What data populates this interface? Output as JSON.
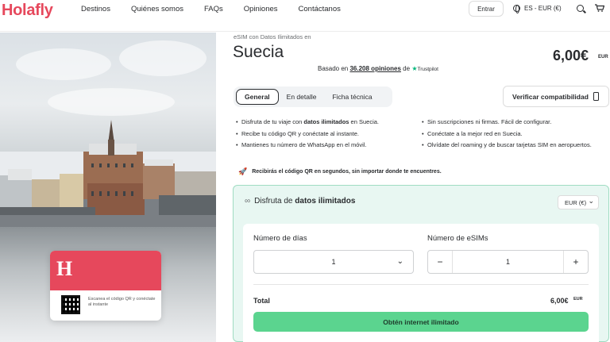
{
  "header": {
    "logo": "Holafly",
    "nav": [
      "Destinos",
      "Quiénes somos",
      "FAQs",
      "Opiniones",
      "Contáctanos"
    ],
    "login_label": "Entrar",
    "locale": "ES - EUR (€)"
  },
  "hero": {
    "card_logo": "H",
    "card_text": "Escanea el código QR y conéctate al instante"
  },
  "product": {
    "eyebrow": "eSIM con Datos Ilimitados en",
    "country": "Suecia",
    "price": "6,00€",
    "price_currency": "EUR",
    "rating_prefix": "Basado en ",
    "rating_count": "36.208 opiniones",
    "rating_suffix": " de",
    "trustpilot": "Trustpilot"
  },
  "tabs": [
    "General",
    "En detalle",
    "Ficha técnica"
  ],
  "compat_label": "Verificar compatibilidad",
  "features_left": [
    [
      "Disfruta de tu viaje con ",
      "datos ilimitados",
      " en Suecia."
    ],
    [
      "Recibe tu código QR y conéctate al instante.",
      "",
      ""
    ],
    [
      "Mantienes tu número de WhatsApp en el móvil.",
      "",
      ""
    ]
  ],
  "features_right": [
    "Sin suscripciones ni firmas. Fácil de configurar.",
    "Conéctate a la mejor red en Suecia.",
    "Olvídate del roaming y de buscar tarjetas SIM en aeropuertos."
  ],
  "qr_note": "Recibirás el código QR en segundos, sin importar donde te encuentres.",
  "plan": {
    "title_prefix": "Disfruta de ",
    "title_bold": "datos ilimitados",
    "currency_select": "EUR (€)",
    "days_label": "Número de días",
    "days_value": "1",
    "esims_label": "Número de eSIMs",
    "esims_value": "1",
    "total_label": "Total",
    "total_value": "6,00€",
    "total_currency": "EUR",
    "cta_label": "Obtén internet ilimitado"
  },
  "colors": {
    "brand": "#e6485c",
    "cta": "#5bd48f",
    "panel_bg": "#e8f7f2"
  }
}
